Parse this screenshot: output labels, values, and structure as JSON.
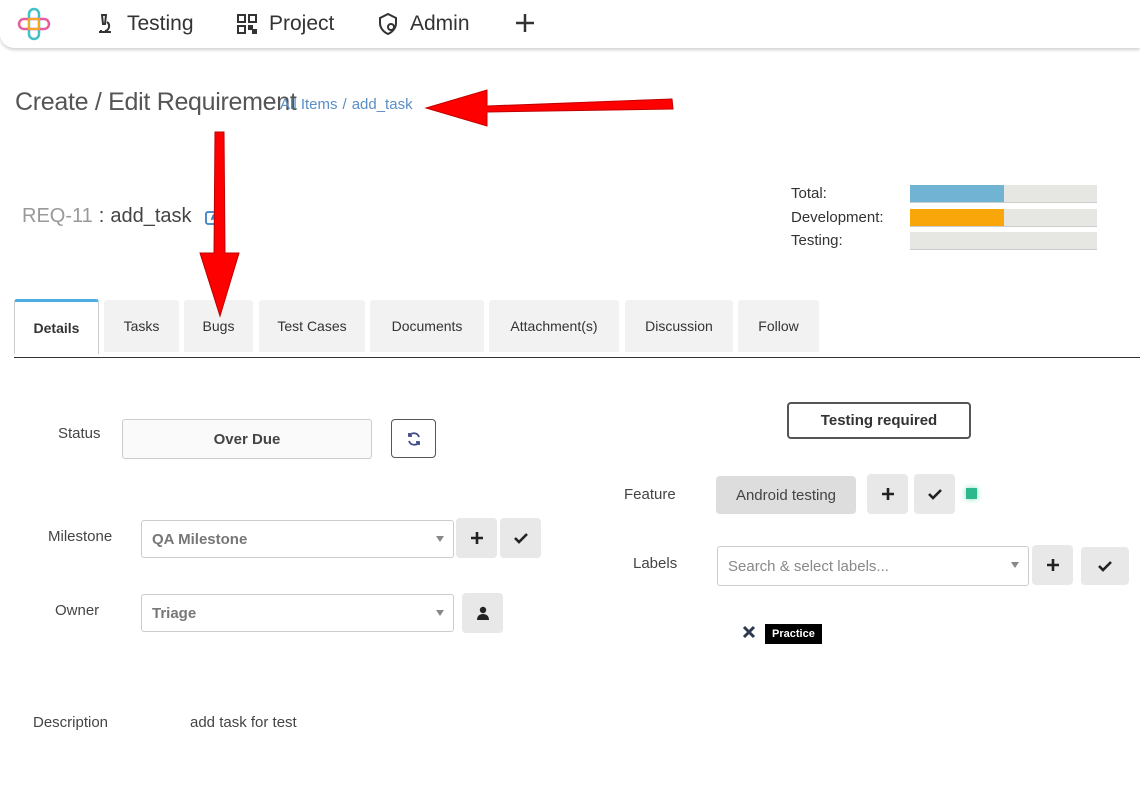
{
  "nav": {
    "items": [
      {
        "label": "Testing",
        "icon": "microscope-icon"
      },
      {
        "label": "Project",
        "icon": "qr-grid-icon"
      },
      {
        "label": "Admin",
        "icon": "admin-shield-icon"
      }
    ],
    "add_icon": "plus-icon"
  },
  "header": {
    "title": "Create / Edit Requirement",
    "breadcrumb": {
      "all_items": "All Items",
      "separator": "/",
      "current": "add_task"
    }
  },
  "requirement": {
    "id": "REQ-11",
    "separator": ":",
    "name": "add_task"
  },
  "progress": {
    "total": {
      "label": "Total:",
      "fraction": 0.5,
      "color": "#70b3d2"
    },
    "development": {
      "label": "Development:",
      "fraction": 0.5,
      "color": "#f9a60b"
    },
    "testing": {
      "label": "Testing:",
      "fraction": 0,
      "color": "#70b3d2"
    }
  },
  "tabs": [
    "Details",
    "Tasks",
    "Bugs",
    "Test Cases",
    "Documents",
    "Attachment(s)",
    "Discussion",
    "Follow"
  ],
  "form": {
    "status": {
      "label": "Status",
      "value": "Over Due"
    },
    "milestone": {
      "label": "Milestone",
      "value": "QA Milestone"
    },
    "owner": {
      "label": "Owner",
      "value": "Triage"
    },
    "testing_required": "Testing required",
    "feature": {
      "label": "Feature",
      "value": "Android testing"
    },
    "labels": {
      "label": "Labels",
      "placeholder": "Search & select labels...",
      "tags": [
        "Practice"
      ]
    },
    "description": {
      "label": "Description",
      "value": "add task for test"
    }
  },
  "colors": {
    "accent": "#4aaee0",
    "link": "#5a8ec6",
    "annotation_arrow": "#ff0000",
    "status_indicator": "#2db88e"
  }
}
